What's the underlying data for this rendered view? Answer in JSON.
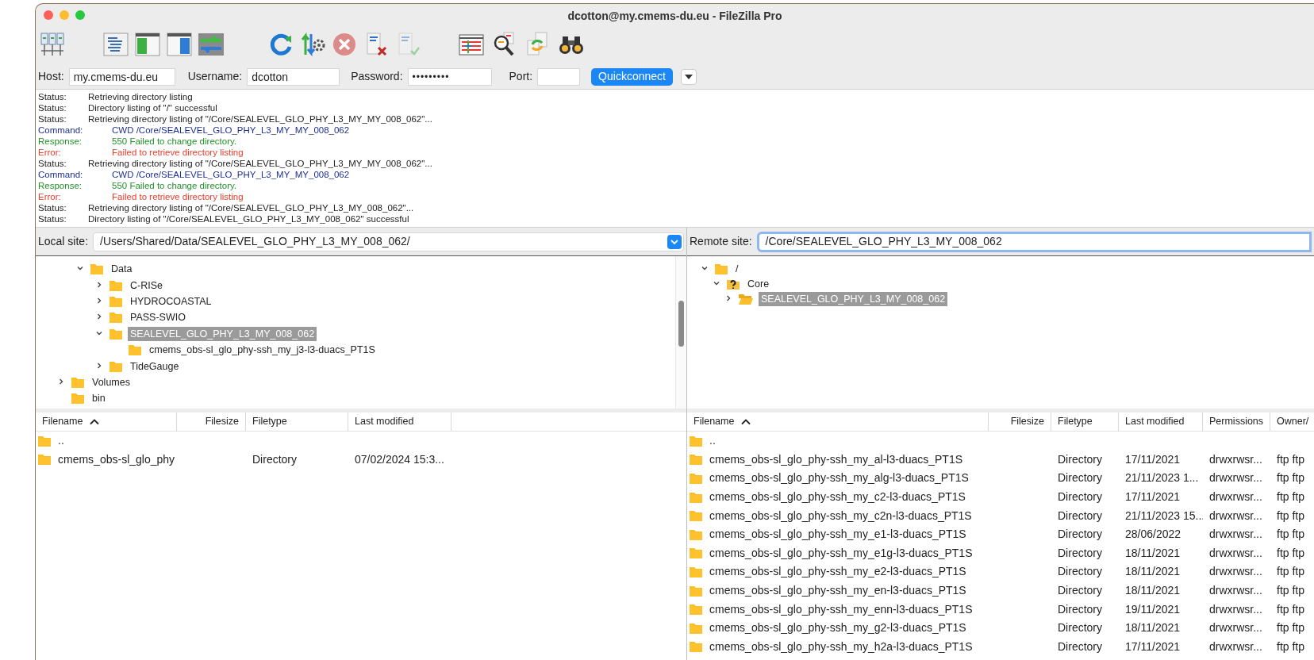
{
  "window": {
    "title": "dcotton@my.cmems-du.eu - FileZilla Pro"
  },
  "quickconnect": {
    "host_label": "Host:",
    "host": "my.cmems-du.eu",
    "username_label": "Username:",
    "username": "dcotton",
    "password_label": "Password:",
    "password": "•••••••••",
    "port_label": "Port:",
    "button": "Quickconnect"
  },
  "log": [
    {
      "kind": "status",
      "label": "Status:",
      "text": "Retrieving directory listing"
    },
    {
      "kind": "status",
      "label": "Status:",
      "text": "Directory listing of \"/\" successful"
    },
    {
      "kind": "status",
      "label": "Status:",
      "text": "Retrieving directory listing of \"/Core/SEALEVEL_GLO_PHY_L3_MY_MY_008_062\"..."
    },
    {
      "kind": "command",
      "label": "Command:",
      "text": "CWD /Core/SEALEVEL_GLO_PHY_L3_MY_MY_008_062"
    },
    {
      "kind": "response",
      "label": "Response:",
      "text": "550 Failed to change directory."
    },
    {
      "kind": "error",
      "label": "Error:",
      "text": "Failed to retrieve directory listing"
    },
    {
      "kind": "status",
      "label": "Status:",
      "text": "Retrieving directory listing of \"/Core/SEALEVEL_GLO_PHY_L3_MY_MY_008_062\"..."
    },
    {
      "kind": "command",
      "label": "Command:",
      "text": "CWD /Core/SEALEVEL_GLO_PHY_L3_MY_MY_008_062"
    },
    {
      "kind": "response",
      "label": "Response:",
      "text": "550 Failed to change directory."
    },
    {
      "kind": "error",
      "label": "Error:",
      "text": "Failed to retrieve directory listing"
    },
    {
      "kind": "status",
      "label": "Status:",
      "text": "Retrieving directory listing of \"/Core/SEALEVEL_GLO_PHY_L3_MY_008_062\"..."
    },
    {
      "kind": "status",
      "label": "Status:",
      "text": "Directory listing of \"/Core/SEALEVEL_GLO_PHY_L3_MY_008_062\" successful"
    }
  ],
  "local": {
    "site_label": "Local site:",
    "path": "/Users/Shared/Data/SEALEVEL_GLO_PHY_L3_MY_008_062/",
    "tree": [
      {
        "children": [
          {
            "label": "Data",
            "kind": "folder",
            "expandable": true,
            "expanded": true,
            "selected": false,
            "children": [
              {
                "label": "C-RISe",
                "kind": "folder",
                "expandable": true,
                "expanded": false,
                "selected": false
              },
              {
                "label": "HYDROCOASTAL",
                "kind": "folder",
                "expandable": true,
                "expanded": false,
                "selected": false
              },
              {
                "label": "PASS-SWIO",
                "kind": "folder",
                "expandable": true,
                "expanded": false,
                "selected": false
              },
              {
                "label": "SEALEVEL_GLO_PHY_L3_MY_008_062",
                "kind": "folder",
                "expandable": true,
                "expanded": true,
                "selected": true,
                "children": [
                  {
                    "label": "cmems_obs-sl_glo_phy-ssh_my_j3-l3-duacs_PT1S",
                    "kind": "folder",
                    "expandable": false,
                    "selected": false
                  }
                ]
              },
              {
                "label": "TideGauge",
                "kind": "folder",
                "expandable": true,
                "expanded": false,
                "selected": false
              }
            ]
          }
        ]
      },
      {
        "label": "Volumes",
        "kind": "folder",
        "expandable": true,
        "expanded": false,
        "selected": false
      },
      {
        "label": "bin",
        "kind": "folder",
        "expandable": false,
        "selected": false
      }
    ],
    "columns": [
      {
        "label": "Filename",
        "sorted": true
      },
      {
        "label": "Filesize",
        "sorted": false
      },
      {
        "label": "Filetype",
        "sorted": false
      },
      {
        "label": "Last modified",
        "sorted": false
      }
    ],
    "rows": [
      {
        "name": ".."
      },
      {
        "name": "cmems_obs-sl_glo_phy",
        "type": "Directory",
        "modified": "07/02/2024 15:3..."
      }
    ]
  },
  "remote": {
    "site_label": "Remote site:",
    "path": "/Core/SEALEVEL_GLO_PHY_L3_MY_008_062",
    "tree": [
      {
        "label": "/",
        "kind": "folder",
        "expandable": true,
        "expanded": true,
        "selected": false,
        "children": [
          {
            "label": "Core",
            "kind": "unknown",
            "expandable": true,
            "expanded": true,
            "selected": false,
            "children": [
              {
                "label": "SEALEVEL_GLO_PHY_L3_MY_008_062",
                "kind": "folder_open",
                "expandable": true,
                "expanded": false,
                "selected": true
              }
            ]
          }
        ]
      }
    ],
    "columns": [
      {
        "label": "Filename",
        "sorted": true
      },
      {
        "label": "Filesize",
        "sorted": false
      },
      {
        "label": "Filetype",
        "sorted": false
      },
      {
        "label": "Last modified",
        "sorted": false
      },
      {
        "label": "Permissions",
        "sorted": false
      },
      {
        "label": "Owner/",
        "sorted": false
      }
    ],
    "rows": [
      {
        "name": ".."
      },
      {
        "name": "cmems_obs-sl_glo_phy-ssh_my_al-l3-duacs_PT1S",
        "type": "Directory",
        "modified": "17/11/2021",
        "permissions": "drwxrwsr...",
        "owner": "ftp ftp"
      },
      {
        "name": "cmems_obs-sl_glo_phy-ssh_my_alg-l3-duacs_PT1S",
        "type": "Directory",
        "modified": "21/11/2023 1...",
        "permissions": "drwxrwsr...",
        "owner": "ftp ftp"
      },
      {
        "name": "cmems_obs-sl_glo_phy-ssh_my_c2-l3-duacs_PT1S",
        "type": "Directory",
        "modified": "17/11/2021",
        "permissions": "drwxrwsr...",
        "owner": "ftp ftp"
      },
      {
        "name": "cmems_obs-sl_glo_phy-ssh_my_c2n-l3-duacs_PT1S",
        "type": "Directory",
        "modified": "21/11/2023 15...",
        "permissions": "drwxrwsr...",
        "owner": "ftp ftp"
      },
      {
        "name": "cmems_obs-sl_glo_phy-ssh_my_e1-l3-duacs_PT1S",
        "type": "Directory",
        "modified": "28/06/2022",
        "permissions": "drwxrwsr...",
        "owner": "ftp ftp"
      },
      {
        "name": "cmems_obs-sl_glo_phy-ssh_my_e1g-l3-duacs_PT1S",
        "type": "Directory",
        "modified": "18/11/2021",
        "permissions": "drwxrwsr...",
        "owner": "ftp ftp"
      },
      {
        "name": "cmems_obs-sl_glo_phy-ssh_my_e2-l3-duacs_PT1S",
        "type": "Directory",
        "modified": "18/11/2021",
        "permissions": "drwxrwsr...",
        "owner": "ftp ftp"
      },
      {
        "name": "cmems_obs-sl_glo_phy-ssh_my_en-l3-duacs_PT1S",
        "type": "Directory",
        "modified": "18/11/2021",
        "permissions": "drwxrwsr...",
        "owner": "ftp ftp"
      },
      {
        "name": "cmems_obs-sl_glo_phy-ssh_my_enn-l3-duacs_PT1S",
        "type": "Directory",
        "modified": "19/11/2021",
        "permissions": "drwxrwsr...",
        "owner": "ftp ftp"
      },
      {
        "name": "cmems_obs-sl_glo_phy-ssh_my_g2-l3-duacs_PT1S",
        "type": "Directory",
        "modified": "18/11/2021",
        "permissions": "drwxrwsr...",
        "owner": "ftp ftp"
      },
      {
        "name": "cmems_obs-sl_glo_phy-ssh_my_h2a-l3-duacs_PT1S",
        "type": "Directory",
        "modified": "17/11/2021",
        "permissions": "drwxrwsr...",
        "owner": "ftp ftp"
      }
    ]
  }
}
